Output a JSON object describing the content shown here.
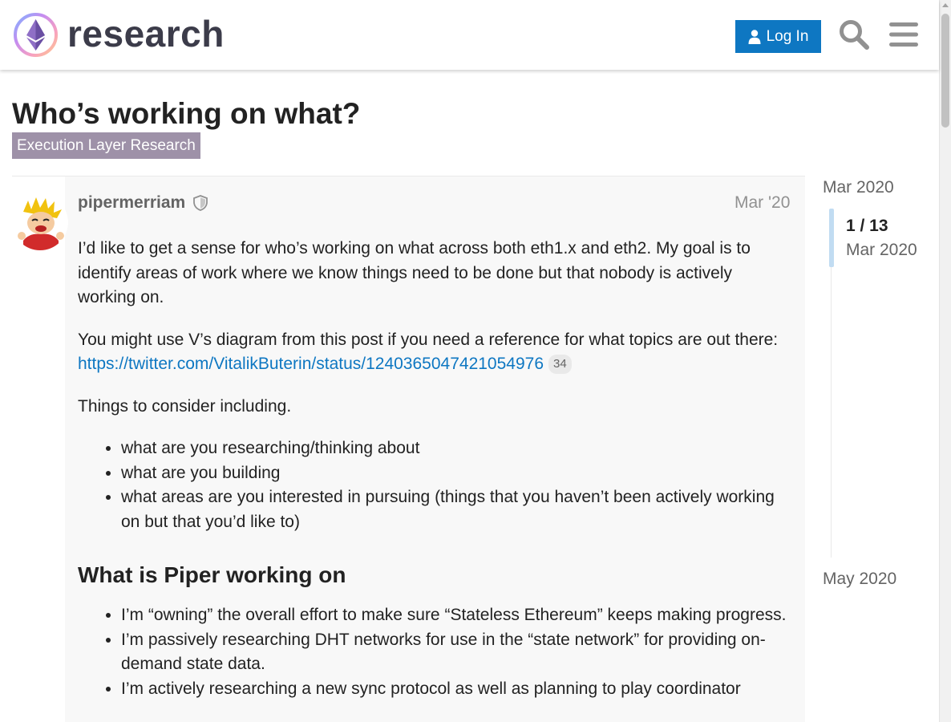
{
  "header": {
    "logo_text": "research",
    "login_label": "Log In",
    "search_icon": "search-icon",
    "menu_icon": "hamburger-menu-icon"
  },
  "topic": {
    "title": "Who’s working on what?",
    "category": "Execution Layer Research"
  },
  "post": {
    "username": "pipermerriam",
    "date": "Mar '20",
    "paragraph1": "I’d like to get a sense for who’s working on what across both eth1.x and eth2. My goal is to identify areas of work where we know things need to be done but that nobody is actively working on.",
    "paragraph2_prefix": "You might use V’s diagram from this post if you need a reference for what topics are out there: ",
    "link_text": "https://twitter.com/VitalikButerin/status/1240365047421054976",
    "link_clicks": "34",
    "paragraph3": "Things to consider including.",
    "consider_list": [
      "what are you researching/thinking about",
      "what are you building",
      "what areas are you interested in pursuing (things that you haven’t been actively working on but that you’d like to)"
    ],
    "heading": "What is Piper working on",
    "piper_list": [
      "I’m “owning” the overall effort to make sure “Stateless Ethereum” keeps making progress.",
      "I’m passively researching DHT networks for use in the “state network” for providing on-demand state data.",
      "I’m actively researching a new sync protocol as well as planning to play coordinator"
    ]
  },
  "timeline": {
    "start_date": "Mar 2020",
    "counter": "1 / 13",
    "counter_date": "Mar 2020",
    "end_date": "May 2020"
  },
  "colors": {
    "accent": "#0e77c2",
    "category": "#9e91a8",
    "title": "#222222",
    "muted": "#646464"
  }
}
